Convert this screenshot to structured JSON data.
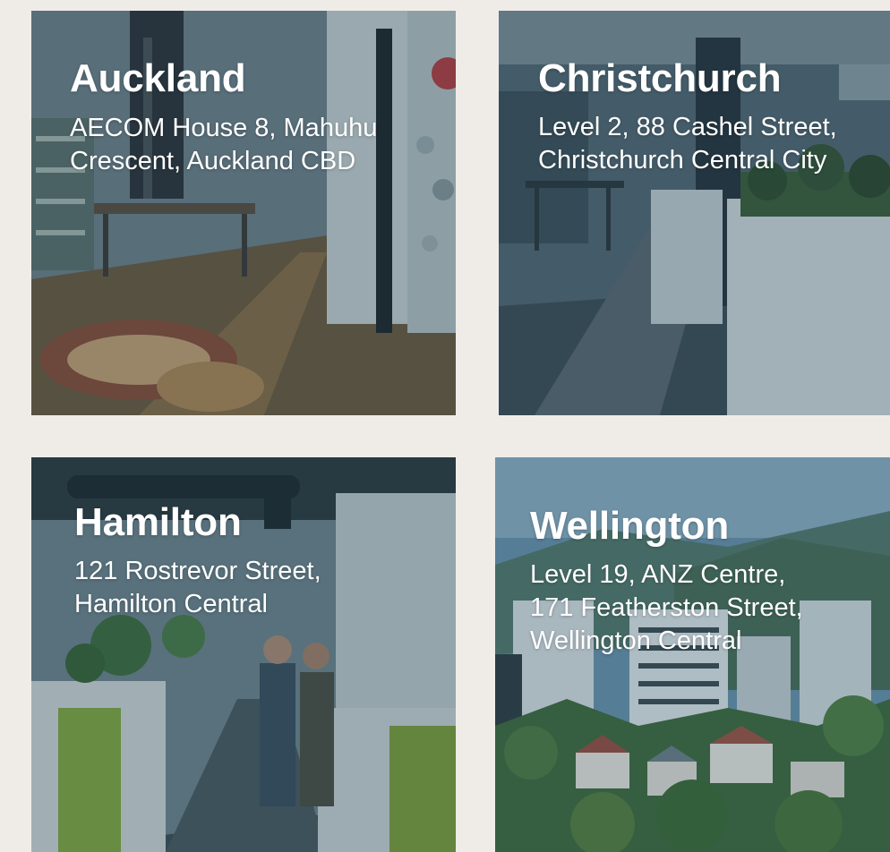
{
  "locations": [
    {
      "id": "auckland",
      "city": "Auckland",
      "address_lines": [
        "AECOM House 8, Mahuhu",
        "Crescent, Auckland CBD"
      ]
    },
    {
      "id": "christchurch",
      "city": "Christchurch",
      "address_lines": [
        "Level 2, 88 Cashel Street,",
        "Christchurch Central City"
      ]
    },
    {
      "id": "hamilton",
      "city": "Hamilton",
      "address_lines": [
        "121 Rostrevor Street,",
        "Hamilton Central"
      ]
    },
    {
      "id": "wellington",
      "city": "Wellington",
      "address_lines": [
        "Level 19, ANZ Centre,",
        "171 Featherston Street,",
        "Wellington Central"
      ]
    }
  ],
  "colors": {
    "page_background": "#efece8",
    "overlay_tint": "#1e465a",
    "text": "#ffffff"
  }
}
